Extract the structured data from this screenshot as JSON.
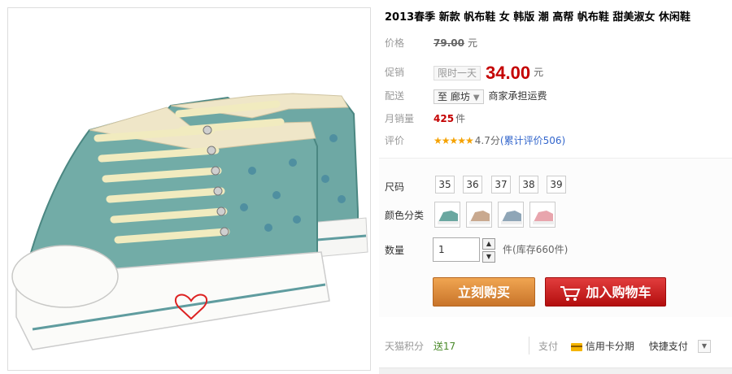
{
  "product": {
    "title": "2013春季 新款 帆布鞋 女 韩版 潮 高帮 帆布鞋 甜美淑女 休闲鞋",
    "image_alt": "teal high-top canvas sneakers with cream laces"
  },
  "price": {
    "label": "价格",
    "original": "79.00",
    "unit": "元"
  },
  "promo": {
    "label": "促销",
    "tag": "限时一天",
    "price": "34.00",
    "unit": "元"
  },
  "shipping": {
    "label": "配送",
    "destination": "至 廊坊",
    "note": "商家承担运费"
  },
  "sales": {
    "label": "月销量",
    "count": "425",
    "unit": "件"
  },
  "rating": {
    "label": "评价",
    "stars": "★★★★★",
    "score": "4.7分",
    "reviews": "(累计评价506)"
  },
  "options": {
    "size_label": "尺码",
    "sizes": [
      "35",
      "36",
      "37",
      "38",
      "39"
    ],
    "color_label": "颜色分类",
    "colors": [
      {
        "name": "teal",
        "hex": "#6aa7a0"
      },
      {
        "name": "beige",
        "hex": "#c9a98f"
      },
      {
        "name": "blue-grey",
        "hex": "#8fa6b7"
      },
      {
        "name": "pink",
        "hex": "#e8a5ad"
      }
    ],
    "qty_label": "数量",
    "qty_value": "1",
    "qty_unit": "件",
    "stock": "(库存660件)"
  },
  "actions": {
    "buy_now": "立刻购买",
    "add_to_cart": "加入购物车"
  },
  "footer": {
    "points_label": "天猫积分",
    "points_value": "送17",
    "pay_label": "支付",
    "credit_label": "信用卡分期",
    "express_label": "快捷支付"
  },
  "colors": {
    "price_red": "#c40000",
    "buy_orange": "#e08a38",
    "cart_red": "#c81a1a",
    "link_blue": "#3366cc"
  }
}
